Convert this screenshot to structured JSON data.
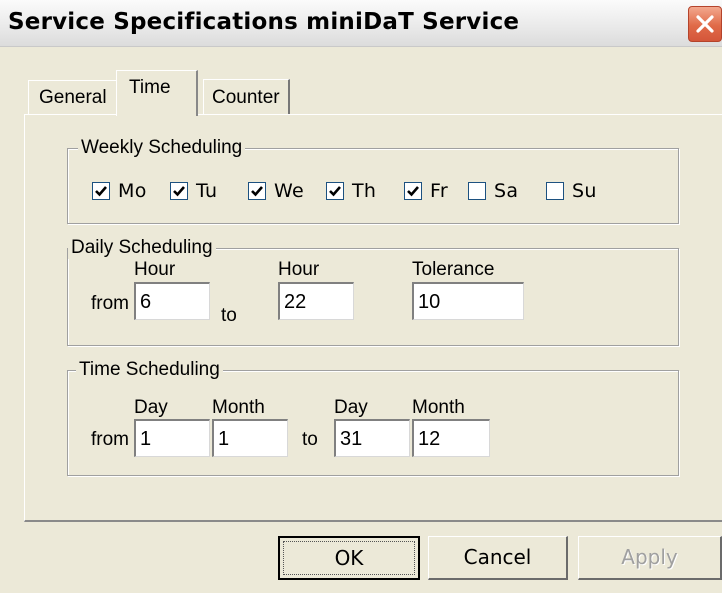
{
  "window": {
    "title": "Service Specifications miniDaT Service",
    "close_icon": "close-icon"
  },
  "tabs": [
    {
      "label": "General",
      "selected": false
    },
    {
      "label": "Time",
      "selected": true
    },
    {
      "label": "Counter",
      "selected": false
    }
  ],
  "weekly": {
    "legend": "Weekly Scheduling",
    "days": [
      {
        "label": "Mo",
        "checked": true
      },
      {
        "label": "Tu",
        "checked": true
      },
      {
        "label": "We",
        "checked": true
      },
      {
        "label": "Th",
        "checked": true
      },
      {
        "label": "Fr",
        "checked": true
      },
      {
        "label": "Sa",
        "checked": false
      },
      {
        "label": "Su",
        "checked": false
      }
    ]
  },
  "daily": {
    "legend": "Daily Scheduling",
    "from_label": "from",
    "to_label": "to",
    "hour_from_label": "Hour",
    "hour_from_value": "6",
    "hour_to_label": "Hour",
    "hour_to_value": "22",
    "tolerance_label": "Tolerance",
    "tolerance_value": "10"
  },
  "time": {
    "legend": "Time Scheduling",
    "from_label": "from",
    "to_label": "to",
    "from_day_label": "Day",
    "from_day_value": "1",
    "from_month_label": "Month",
    "from_month_value": "1",
    "to_day_label": "Day",
    "to_day_value": "31",
    "to_month_label": "Month",
    "to_month_value": "12"
  },
  "buttons": {
    "ok": "OK",
    "cancel": "Cancel",
    "apply": "Apply",
    "apply_enabled": false
  }
}
